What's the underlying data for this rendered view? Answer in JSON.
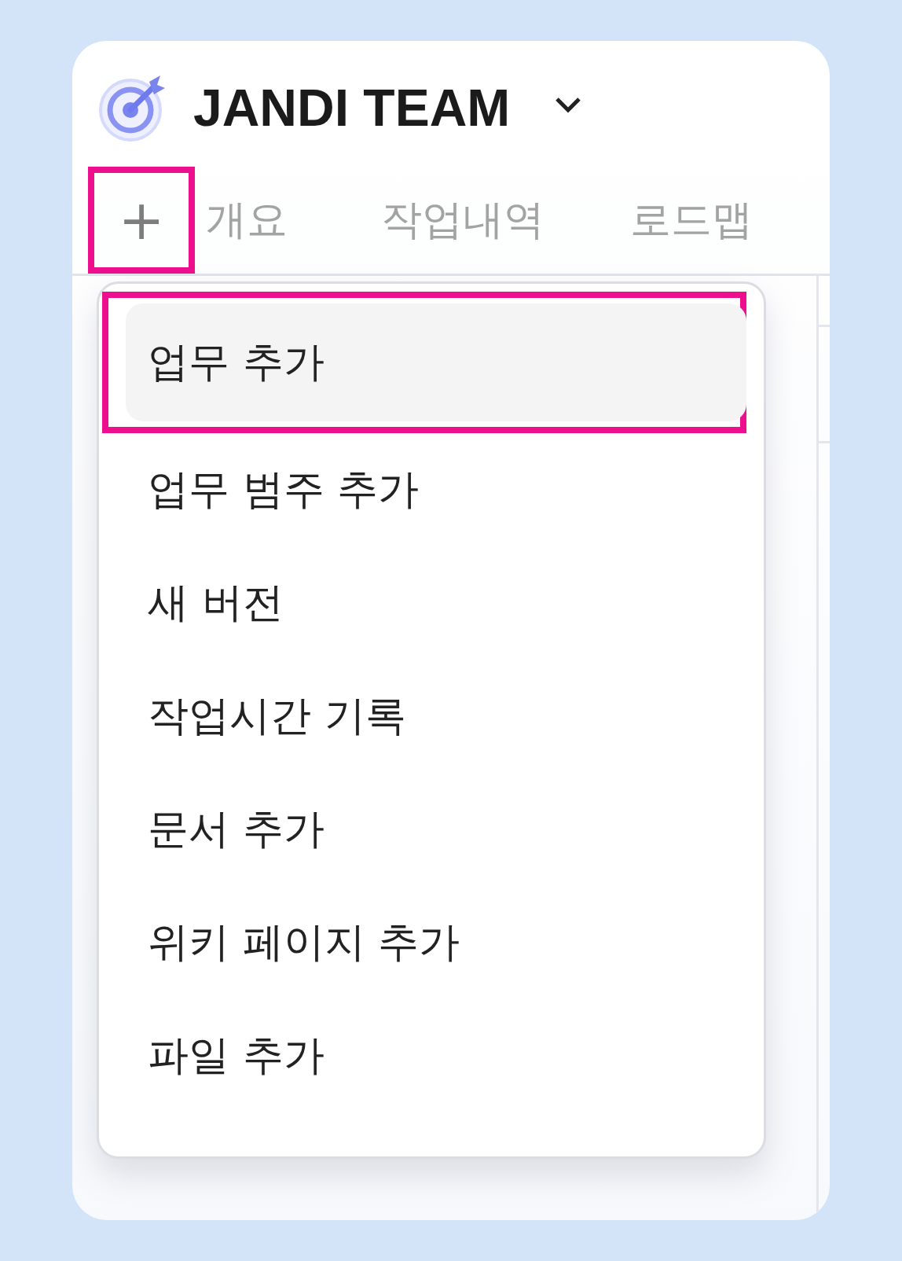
{
  "header": {
    "title": "JANDI TEAM"
  },
  "add_button": {
    "label": "+",
    "annotated": true
  },
  "tabs": [
    {
      "label": "개요",
      "selected": false
    },
    {
      "label": "작업내역",
      "selected": false
    },
    {
      "label": "로드맵",
      "selected": false
    }
  ],
  "menu": {
    "items": [
      {
        "label": "업무 추가",
        "selected": true,
        "annotated": true
      },
      {
        "label": "업무 범주 추가",
        "selected": false,
        "annotated": false
      },
      {
        "label": "새 버전",
        "selected": false,
        "annotated": false
      },
      {
        "label": "작업시간 기록",
        "selected": false,
        "annotated": false
      },
      {
        "label": "문서 추가",
        "selected": false,
        "annotated": false
      },
      {
        "label": "위키 페이지 추가",
        "selected": false,
        "annotated": false
      },
      {
        "label": "파일 추가",
        "selected": false,
        "annotated": false
      }
    ]
  }
}
